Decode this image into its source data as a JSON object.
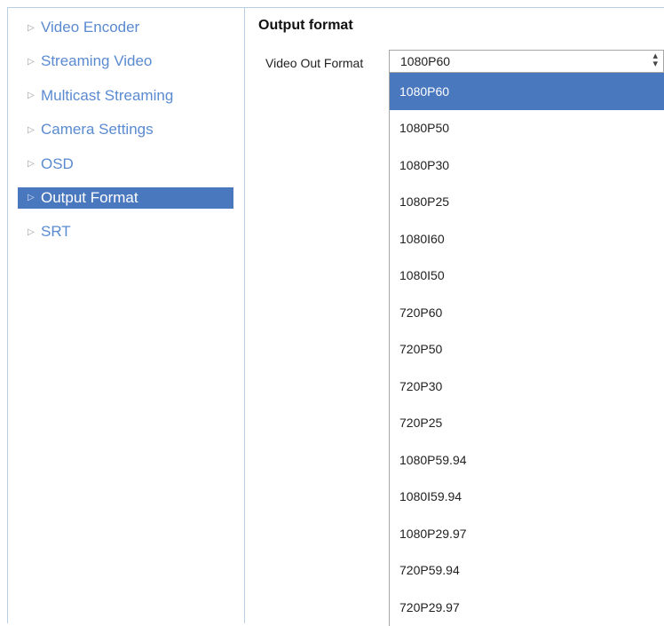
{
  "sidebar": {
    "items": [
      {
        "label": "Video Encoder",
        "active": false
      },
      {
        "label": "Streaming Video",
        "active": false
      },
      {
        "label": "Multicast Streaming",
        "active": false
      },
      {
        "label": "Camera Settings",
        "active": false
      },
      {
        "label": "OSD",
        "active": false
      },
      {
        "label": "Output Format",
        "active": true
      },
      {
        "label": "SRT",
        "active": false
      }
    ]
  },
  "main": {
    "title": "Output format",
    "video_out_format": {
      "label": "Video Out Format",
      "value": "1080P60",
      "options": [
        "1080P60",
        "1080P50",
        "1080P30",
        "1080P25",
        "1080I60",
        "1080I50",
        "720P60",
        "720P50",
        "720P30",
        "720P25",
        "1080P59.94",
        "1080I59.94",
        "1080P29.97",
        "720P59.94",
        "720P29.97"
      ]
    }
  },
  "colors": {
    "accent": "#4a78bf",
    "link": "#5a8ad0",
    "border": "#b9cde3"
  },
  "icons": {
    "nav_arrow": "triangle-right-icon",
    "select_chevron": "up-down-chevron-icon"
  }
}
